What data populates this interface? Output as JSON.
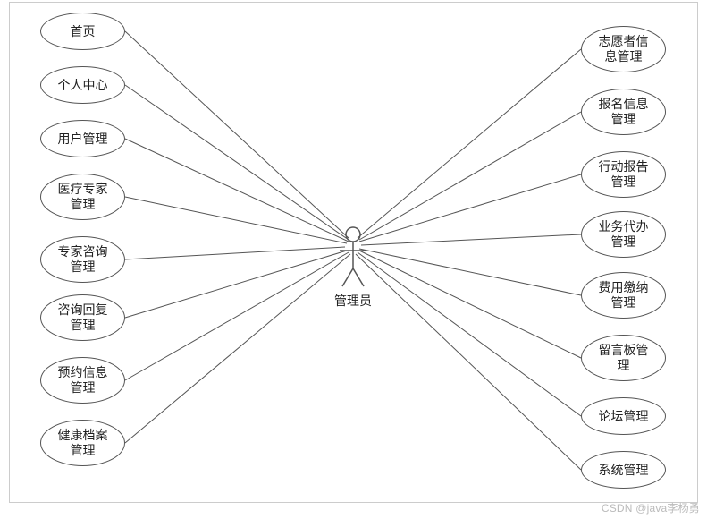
{
  "actor": {
    "label": "管理员"
  },
  "left": [
    {
      "label": "首页"
    },
    {
      "label": "个人中心"
    },
    {
      "label": "用户管理"
    },
    {
      "label": "医疗专家\n管理"
    },
    {
      "label": "专家咨询\n管理"
    },
    {
      "label": "咨询回复\n管理"
    },
    {
      "label": "预约信息\n管理"
    },
    {
      "label": "健康档案\n管理"
    }
  ],
  "right": [
    {
      "label": "志愿者信\n息管理"
    },
    {
      "label": "报名信息\n管理"
    },
    {
      "label": "行动报告\n管理"
    },
    {
      "label": "业务代办\n管理"
    },
    {
      "label": "费用缴纳\n管理"
    },
    {
      "label": "留言板管\n理"
    },
    {
      "label": "论坛管理"
    },
    {
      "label": "系统管理"
    }
  ],
  "watermark": "CSDN @java李杨勇",
  "chart_data": {
    "type": "table",
    "title": "UML Use Case Diagram",
    "actor": "管理员",
    "use_cases_left": [
      "首页",
      "个人中心",
      "用户管理",
      "医疗专家管理",
      "专家咨询管理",
      "咨询回复管理",
      "预约信息管理",
      "健康档案管理"
    ],
    "use_cases_right": [
      "志愿者信息管理",
      "报名信息管理",
      "行动报告管理",
      "业务代办管理",
      "费用缴纳管理",
      "留言板管理",
      "论坛管理",
      "系统管理"
    ]
  }
}
